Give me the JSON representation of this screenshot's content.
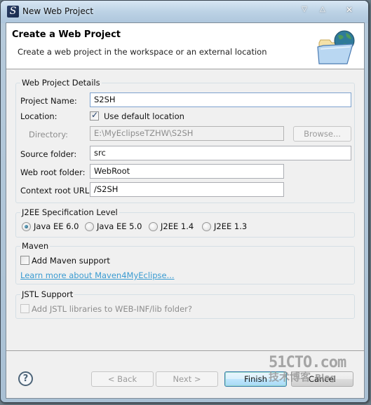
{
  "window": {
    "title": "New Web Project",
    "app_icon_glyph": "S",
    "controls": {
      "minimize": "▽",
      "maximize": "△",
      "close": "✕"
    }
  },
  "banner": {
    "title": "Create a Web Project",
    "description": "Create a web project in the workspace or an external location",
    "icon": "folder-globe-icon"
  },
  "details": {
    "group_label": "Web Project Details",
    "project_name_label": "Project Name:",
    "project_name_value": "S2SH",
    "location_label": "Location:",
    "use_default_location_label": "Use default location",
    "use_default_location_checked": true,
    "directory_label": "Directory:",
    "directory_value": "E:\\MyEclipseTZHW\\S2SH",
    "browse_label": "Browse...",
    "source_folder_label": "Source folder:",
    "source_folder_value": "src",
    "web_root_label": "Web root folder:",
    "web_root_value": "WebRoot",
    "context_root_label": "Context root URL:",
    "context_root_value": "/S2SH"
  },
  "j2ee": {
    "group_label": "J2EE Specification Level",
    "options": [
      {
        "label": "Java EE 6.0",
        "selected": true
      },
      {
        "label": "Java EE 5.0",
        "selected": false
      },
      {
        "label": "J2EE 1.4",
        "selected": false
      },
      {
        "label": "J2EE 1.3",
        "selected": false
      }
    ]
  },
  "maven": {
    "group_label": "Maven",
    "add_support_label": "Add Maven support",
    "add_support_checked": false,
    "learn_more_link": "Learn more about Maven4MyEclipse..."
  },
  "jstl": {
    "group_label": "JSTL Support",
    "add_libraries_label": "Add JSTL libraries to WEB-INF/lib folder?",
    "add_libraries_checked": false,
    "enabled": false
  },
  "footer": {
    "help_glyph": "?",
    "back_label": "< Back",
    "next_label": "Next >",
    "finish_label": "Finish",
    "cancel_label": "Cancel"
  },
  "watermark": {
    "top": "51CTO.com",
    "bottom": "技术博客",
    "blog": "Blog"
  },
  "colors": {
    "link": "#3a9bd1",
    "default_button_border": "#3c7fb1",
    "dialog_bg": "#f0f0f0"
  }
}
